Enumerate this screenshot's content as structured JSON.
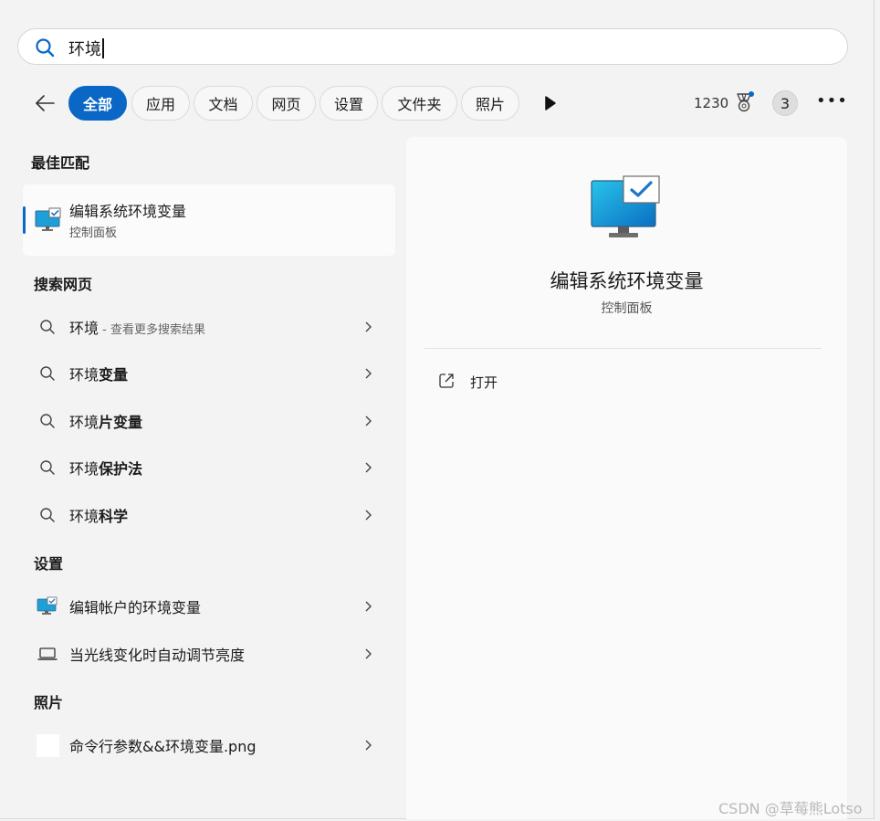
{
  "search": {
    "query": "环境"
  },
  "filters": {
    "back_icon": "arrow-left-icon",
    "chips": [
      "全部",
      "应用",
      "文档",
      "网页",
      "设置",
      "文件夹",
      "照片"
    ],
    "more_filters_icon": "play-icon",
    "points": "1230",
    "rewards_icon": "medal-icon",
    "badge_count": "3",
    "more_icon": "ellipsis-icon"
  },
  "best_match": {
    "heading": "最佳匹配",
    "title": "编辑系统环境变量",
    "subtitle": "控制面板"
  },
  "web_search": {
    "heading": "搜索网页",
    "items": [
      {
        "prefix": "环境",
        "bold": "",
        "hint": " - 查看更多搜索结果"
      },
      {
        "prefix": "环境",
        "bold": "变量",
        "hint": ""
      },
      {
        "prefix": "环境",
        "bold": "片变量",
        "hint": ""
      },
      {
        "prefix": "环境",
        "bold": "保护法",
        "hint": ""
      },
      {
        "prefix": "环境",
        "bold": "科学",
        "hint": ""
      }
    ]
  },
  "settings": {
    "heading": "设置",
    "items": [
      {
        "label": "编辑帐户的环境变量",
        "icon": "monitor-settings-icon"
      },
      {
        "label": "当光线变化时自动调节亮度",
        "icon": "laptop-icon"
      }
    ]
  },
  "photos": {
    "heading": "照片",
    "items": [
      {
        "label": "命令行参数&&环境变量.png",
        "icon": "image-thumbnail-icon"
      }
    ]
  },
  "detail": {
    "title": "编辑系统环境变量",
    "subtitle": "控制面板",
    "actions": [
      {
        "label": "打开",
        "icon": "open-external-icon"
      }
    ]
  },
  "watermark": "CSDN @草莓熊Lotso",
  "colors": {
    "accent": "#0a67c5",
    "background": "#f3f3f3",
    "panel": "#fafafa"
  }
}
